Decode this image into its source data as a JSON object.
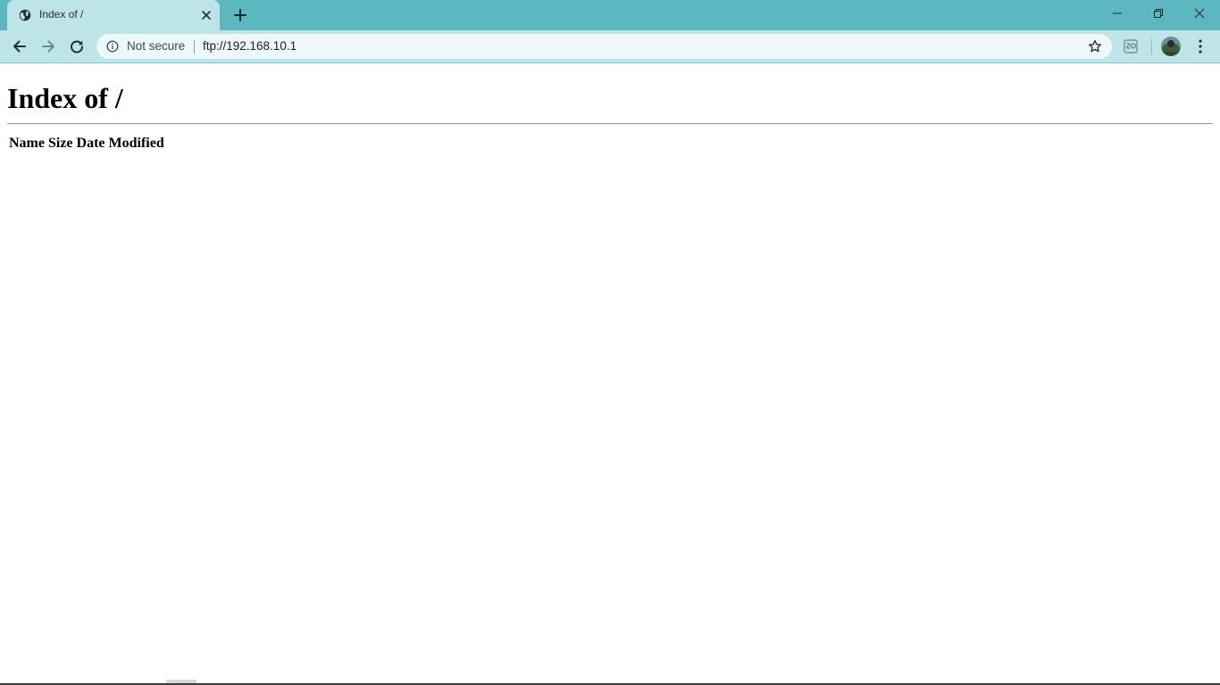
{
  "browser": {
    "tab": {
      "title": "Index of /"
    },
    "window_buttons": {
      "minimize": "minimize",
      "maximize": "restore",
      "close": "close"
    },
    "omnibox": {
      "security_label": "Not secure",
      "url": "ftp://192.168.10.1"
    },
    "colors": {
      "tabstrip": "#5cb7c1",
      "toolbar": "#bde4e7",
      "omnibox": "#eef8f9"
    },
    "icons": {
      "tab_favicon": "globe-icon",
      "tab_close": "close-icon",
      "new_tab": "plus-icon",
      "back": "arrow-left-icon",
      "forward": "arrow-right-icon",
      "reload": "reload-icon",
      "site_info": "info-icon",
      "bookmark": "star-icon",
      "extension": "extension-icon",
      "profile": "avatar",
      "menu": "kebab-menu-icon"
    }
  },
  "page": {
    "heading": "Index of /",
    "table": {
      "columns": [
        "Name",
        "Size",
        "Date Modified"
      ],
      "rows": []
    }
  }
}
